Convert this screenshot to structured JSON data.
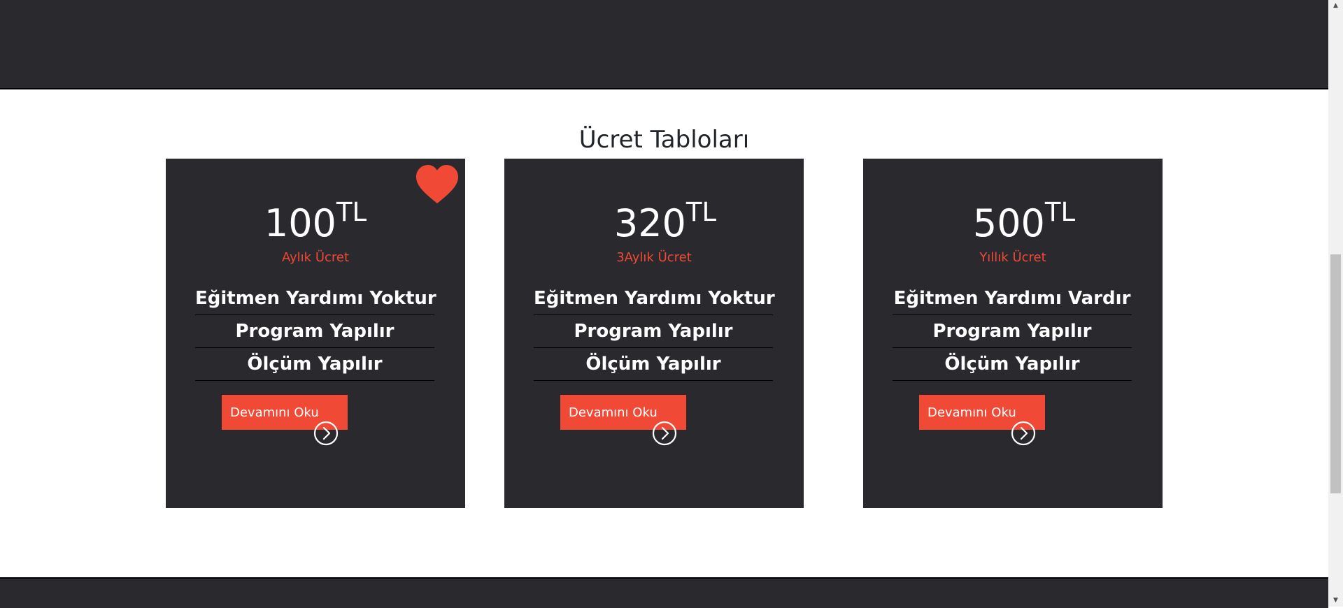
{
  "page": {
    "section_title": "Ücret Tabloları"
  },
  "cards": [
    {
      "price": "100",
      "currency": "TL",
      "period": "Aylık Ücret",
      "features": [
        "Eğitmen Yardımı Yoktur",
        "Program Yapılır",
        "Ölçüm Yapılır"
      ],
      "button_label": "Devamını Oku",
      "featured_icon": "heart-icon"
    },
    {
      "price": "320",
      "currency": "TL",
      "period": "3Aylık Ücret",
      "features": [
        "Eğitmen Yardımı Yoktur",
        "Program Yapılır",
        "Ölçüm Yapılır"
      ],
      "button_label": "Devamını Oku"
    },
    {
      "price": "500",
      "currency": "TL",
      "period": "Yıllık Ücret",
      "features": [
        "Eğitmen Yardımı Vardır",
        "Program Yapılır",
        "Ölçüm Yapılır"
      ],
      "button_label": "Devamını Oku"
    }
  ],
  "colors": {
    "dark_bg": "#2a292e",
    "accent": "#f04a36",
    "text_light": "#ffffff",
    "title_text": "#212529"
  },
  "icons": {
    "heart": "heart-icon",
    "arrow": "chevron-right-circle-icon",
    "scroll_up": "scroll-up-arrow-icon",
    "scroll_down": "scroll-down-arrow-icon"
  }
}
